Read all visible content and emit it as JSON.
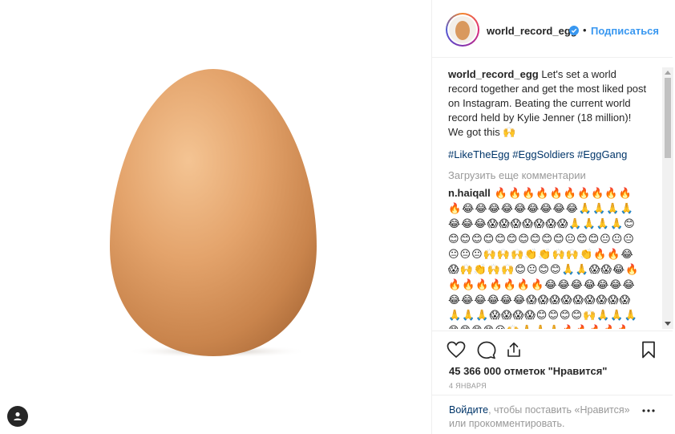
{
  "post": {
    "username": "world_record_egg",
    "follow_label": "Подписаться",
    "separator": "•",
    "caption_user": "world_record_egg",
    "caption_text": " Let's set a world record together and get the most liked post on Instagram. Beating the current world record held by Kylie Jenner (18 million)! We got this 🙌",
    "hashtags": "#LikeTheEgg #EggSoldiers #EggGang",
    "load_more": "Загрузить еще комментарии",
    "comment_user": "n.haiqall",
    "comment_text": " 🔥🔥🔥🔥🔥🔥🔥🔥🔥🔥🔥😂😂😂😂😂😂😂😂😂🙏🙏🙏🙏😂😂😂😱😱😱😱😱😱😱🙏🙏🙏🙏😊😊😊😊😊😊😊😊😊😊😊😐😊😊😐😐😐😐😐😐🙌🙌🙌👏👏🙌🙌👏🔥🔥😂😱🙌👏🙌🙌😊😐😊😊🙏🙏😱😱😂🔥🔥🔥🔥🔥🔥🔥🔥😂😂😂😂😂😂😂😂😂😂😂😂😂😱😱😱😱😱😱😱😱😱🙏🙏🙏😱😱😱😱😊😊😊😊🙌🙏🙏🙏😊😊😊😊😐🙌🙏🙏🙏🔥🔥🔥🔥🔥🔥",
    "likes": "45 366 000 отметок \"Нравится\"",
    "date": "4 ЯНВАРЯ",
    "login_link": "Войдите",
    "login_rest": ", чтобы поставить «Нравится» или прокомментировать."
  },
  "icons": {
    "heart": "heart-icon",
    "comment": "comment-icon",
    "share": "share-icon",
    "save": "bookmark-icon",
    "more": "more-dots-icon",
    "verified": "verified-badge-icon",
    "account": "account-icon"
  },
  "colors": {
    "link": "#3897f0",
    "hashtag": "#003569",
    "muted": "#999999",
    "egg": "#e3a875"
  }
}
